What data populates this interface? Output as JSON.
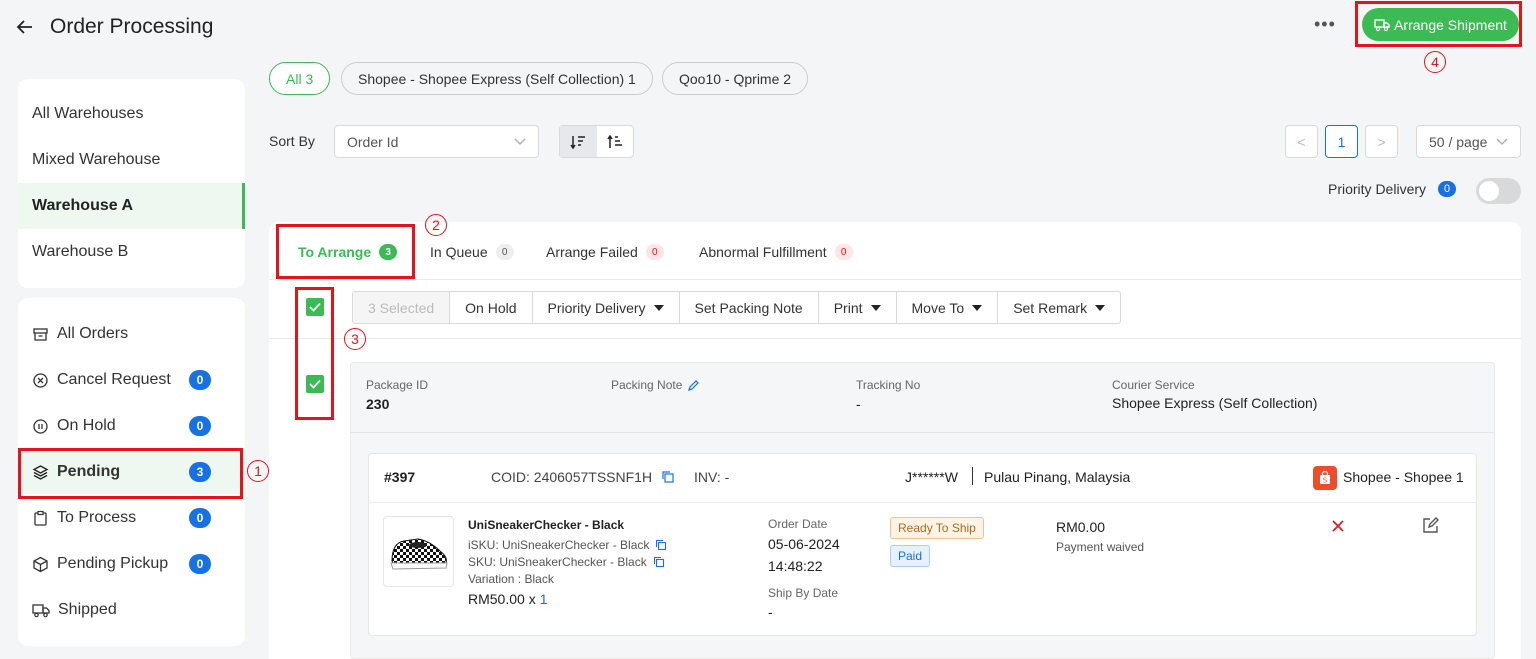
{
  "header": {
    "title": "Order Processing",
    "arrange_label": "Arrange Shipment",
    "more": "•••"
  },
  "warehouses": [
    "All Warehouses",
    "Mixed Warehouse",
    "Warehouse A",
    "Warehouse B"
  ],
  "nav": [
    {
      "label": "All Orders",
      "icon": "inbox-icon",
      "count": null
    },
    {
      "label": "Cancel Request",
      "icon": "cancel-circle-icon",
      "count": "0"
    },
    {
      "label": "On Hold",
      "icon": "pause-circle-icon",
      "count": "0"
    },
    {
      "label": "Pending",
      "icon": "layers-icon",
      "count": "3"
    },
    {
      "label": "To Process",
      "icon": "clipboard-icon",
      "count": "0"
    },
    {
      "label": "Pending Pickup",
      "icon": "box-icon",
      "count": "0"
    },
    {
      "label": "Shipped",
      "icon": "truck-icon",
      "count": null
    }
  ],
  "filters": [
    "All 3",
    "Shopee - Shopee Express (Self Collection) 1",
    "Qoo10 - Qprime 2"
  ],
  "sort": {
    "label": "Sort By",
    "value": "Order Id"
  },
  "pagination": {
    "page": "1",
    "per_page": "50 / page",
    "prev": "<",
    "next": ">"
  },
  "priority": {
    "label": "Priority Delivery",
    "count": "0"
  },
  "tabs": [
    {
      "label": "To Arrange",
      "count": "3"
    },
    {
      "label": "In Queue",
      "count": "0"
    },
    {
      "label": "Arrange Failed",
      "count": "0"
    },
    {
      "label": "Abnormal Fulfillment",
      "count": "0"
    }
  ],
  "actions": [
    "3 Selected",
    "On Hold",
    "Priority Delivery",
    "Set Packing Note",
    "Print",
    "Move To",
    "Set Remark"
  ],
  "package": {
    "id_label": "Package ID",
    "id": "230",
    "note_label": "Packing Note",
    "tracking_label": "Tracking No",
    "tracking": "-",
    "courier_label": "Courier Service",
    "courier": "Shopee Express (Self Collection)"
  },
  "order": {
    "number": "#397",
    "coid": "COID: 2406057TSSNF1H",
    "inv": "INV: -",
    "customer": "J******W",
    "location": "Pulau Pinang, Malaysia",
    "store": "Shopee - Shopee 1",
    "product": "UniSneakerChecker - Black",
    "isku": "iSKU: UniSneakerChecker - Black",
    "sku": "SKU: UniSneakerChecker - Black",
    "variation": "Variation : Black",
    "price": "RM50.00 x",
    "qty": "1",
    "order_date_label": "Order Date",
    "order_date": "05-06-2024",
    "order_time": "14:48:22",
    "ship_by_label": "Ship By Date",
    "ship_by": "-",
    "status": "Ready To Ship",
    "payment_status": "Paid",
    "amount": "RM0.00",
    "payment_note": "Payment waived"
  },
  "annotations": [
    "1",
    "2",
    "3",
    "4"
  ],
  "colors": {
    "accent": "#3cba54",
    "annotation": "#e3141b",
    "badge": "#1671e4"
  }
}
